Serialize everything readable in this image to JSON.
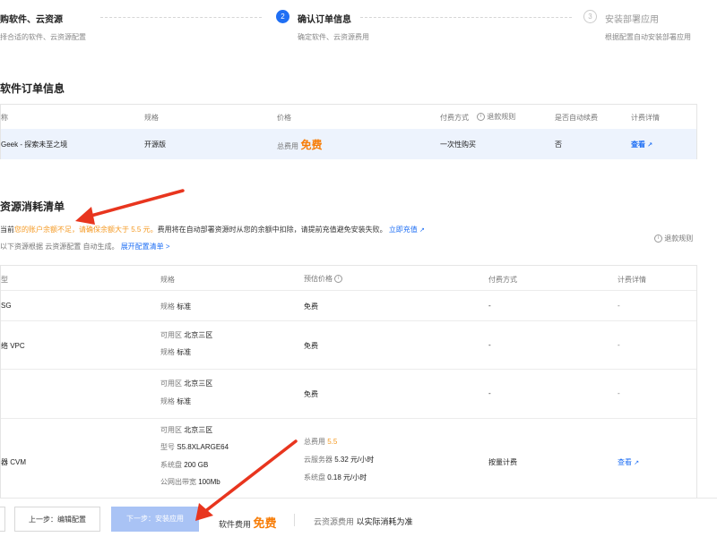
{
  "steps": [
    {
      "title": "购软件、云资源",
      "desc": "择合适的软件、云资源配置"
    },
    {
      "num": "2",
      "title": "确认订单信息",
      "desc": "确定软件、云资源费用"
    },
    {
      "num": "3",
      "title": "安装部署应用",
      "desc": "根据配置自动安装部署应用"
    }
  ],
  "software_section": {
    "title": "软件订单信息",
    "headers": {
      "name": "称",
      "spec": "规格",
      "price": "价格",
      "pay": "付费方式",
      "refund": "退款规则",
      "auto_renew": "是否自动续费",
      "billing": "计费详情"
    },
    "row": {
      "name": "Geek - 探索未至之境",
      "spec": "开源版",
      "price_label": "总费用",
      "price_value": "免费",
      "pay": "一次性购买",
      "auto_renew": "否",
      "billing_link": "查看"
    }
  },
  "resource_section": {
    "title": "资源消耗清单",
    "notice_prefix": "当前",
    "notice_warning": "您的账户余额不足，请确保余额大于 5.5 元。",
    "notice_rest": "费用将在自动部署资源时从您的余额中扣除，请提前充值避免安装失败。",
    "recharge_link": "立即充值",
    "sub_note": "以下资源根据 云资源配置 自动生成。",
    "expand_link": "展开配置清单 >",
    "refund_rule": "退款规则",
    "headers": {
      "type": "型",
      "spec": "规格",
      "price": "预估价格",
      "pay": "付费方式",
      "billing": "计费详情"
    },
    "rows": [
      {
        "type": "SG",
        "spec": [
          {
            "k": "规格",
            "v": "标准"
          }
        ],
        "price": "免费",
        "pay": "-",
        "billing": "-"
      },
      {
        "type": "络 VPC",
        "spec": [
          {
            "k": "可用区",
            "v": "北京三区"
          },
          {
            "k": "规格",
            "v": "标准"
          }
        ],
        "price": "免费",
        "pay": "-",
        "billing": "-"
      },
      {
        "type": "",
        "spec": [
          {
            "k": "可用区",
            "v": "北京三区"
          },
          {
            "k": "规格",
            "v": "标准"
          }
        ],
        "price": "免费",
        "pay": "-",
        "billing": "-"
      },
      {
        "type": "器 CVM",
        "spec": [
          {
            "k": "可用区",
            "v": "北京三区"
          },
          {
            "k": "型号",
            "v": "S5.8XLARGE64"
          },
          {
            "k": "系统盘",
            "v": "200 GB"
          },
          {
            "k": "公网出带宽",
            "v": "100Mb"
          }
        ],
        "price_lines": [
          {
            "k": "总费用",
            "v": "5.5"
          },
          {
            "k": "云服务器",
            "v": "5.32 元/小时"
          },
          {
            "k": "系统盘",
            "v": "0.18 元/小时"
          }
        ],
        "pay": "按量计费",
        "billing": "查看"
      }
    ]
  },
  "footer": {
    "prev_button": "上一步：编辑配置",
    "next_button": "下一步：安装应用",
    "software_fee_label": "软件费用",
    "software_fee_value": "免费",
    "cloud_fee_label": "云资源费用",
    "cloud_fee_value": "以实际消耗为准"
  },
  "colors": {
    "accent": "#1f6ff4",
    "warning": "#f77c06",
    "arrow": "#e8351e"
  }
}
